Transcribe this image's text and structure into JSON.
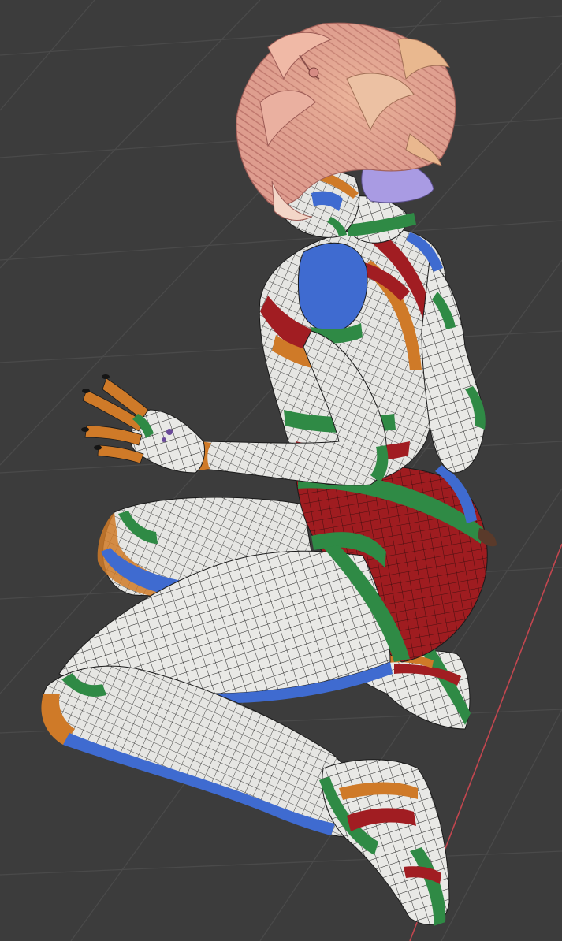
{
  "viewport": {
    "label": "",
    "background_color": "#3c3c3c",
    "grid_line_color": "#4a4a4a",
    "axis_line_color": "#c2464f"
  },
  "model": {
    "shading": "checker-uv-wireframe",
    "pose": "kneeling",
    "colors": {
      "skin_base": "#e9e9e6",
      "wire": "#1a1a1a",
      "red": "#a11d22",
      "green": "#2f8a45",
      "blue": "#3f6bd0",
      "orange": "#cf7a28",
      "hair_pink": "#e8a296",
      "hair_peach": "#e7b38e",
      "hair_lavender": "#a99be3",
      "nail": "#151515"
    }
  }
}
